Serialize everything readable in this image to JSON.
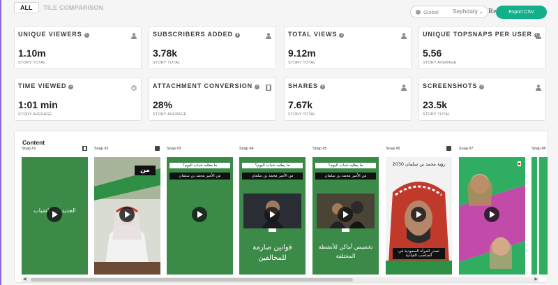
{
  "tabs": {
    "all": "ALL",
    "tile_comparison": "TILE COMPARISON"
  },
  "filter": {
    "label": "Global",
    "brand": "Sephdaty",
    "icon": "globe-icon"
  },
  "user_name": "Rehab",
  "export_label": "Export CSV",
  "colors": {
    "accent": "#12b08a",
    "snap_green": "#3a8a48",
    "rule_purple": "#8e6bd6"
  },
  "metrics": [
    {
      "label": "UNIQUE VIEWERS",
      "value": "1.10m",
      "sub": "STORY TOTAL",
      "icon": "person-icon"
    },
    {
      "label": "SUBSCRIBERS ADDED",
      "value": "3.78k",
      "sub": "STORY TOTAL",
      "icon": "person-icon"
    },
    {
      "label": "TOTAL VIEWS",
      "value": "9.12m",
      "sub": "STORY TOTAL",
      "icon": "person-icon"
    },
    {
      "label": "UNIQUE TOPSNAPS PER USER",
      "value": "5.56",
      "sub": "STORY AVERAGE",
      "icon": "person-icon"
    },
    {
      "label": "TIME VIEWED",
      "value": "1:01 min",
      "sub": "STORY AVERAGE",
      "icon": "clock-icon"
    },
    {
      "label": "ATTACHMENT CONVERSION",
      "value": "28%",
      "sub": "STORY AVERAGE",
      "icon": "film-icon"
    },
    {
      "label": "SHARES",
      "value": "7.67k",
      "sub": "STORY TOTAL",
      "icon": "person-icon"
    },
    {
      "label": "SCREENSHOTS",
      "value": "23.5k",
      "sub": "STORY TOTAL",
      "icon": "person-icon"
    }
  ],
  "content": {
    "title": "Content",
    "snaps": [
      {
        "label": "Snap #1",
        "type_icon": "film-icon",
        "text": "الجديد عن الشباب"
      },
      {
        "label": "Snap #2",
        "type_icon": "book-icon",
        "text": "من"
      },
      {
        "label": "Snap #3",
        "type_icon": "",
        "quote": "ما يطلبه شباب اليوم؟",
        "sub": "من الأمير محمد بن سلمان"
      },
      {
        "label": "Snap #4",
        "type_icon": "",
        "quote": "ما يطلبه شباب اليوم؟",
        "sub": "من الأمير محمد بن سلمان",
        "bottom": "قوانين صارمة للمخالفين"
      },
      {
        "label": "Snap #5",
        "type_icon": "",
        "quote": "ما يطلبه شباب اليوم؟",
        "sub": "من الأمير محمد بن سلمان",
        "bottom": "تخصيص أماكن للأنشطة المختلفة"
      },
      {
        "label": "Snap #6",
        "type_icon": "book-icon",
        "top": "رؤية محمد بن سلمان 2030",
        "caption": "تصدر المرأة السعودية في المناصب القيادية"
      },
      {
        "label": "Snap #7",
        "type_icon": "",
        "text": ""
      },
      {
        "label": "Snap #8",
        "type_icon": "",
        "text": ""
      }
    ]
  }
}
